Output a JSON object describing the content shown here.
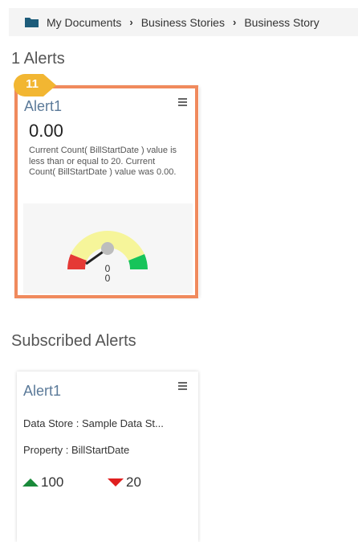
{
  "breadcrumb": {
    "items": [
      "My Documents",
      "Business Stories",
      "Business Story"
    ]
  },
  "alerts_section": {
    "title": "1 Alerts",
    "card": {
      "name": "Alert1",
      "value": "0.00",
      "description": "Current Count( BillStartDate ) value is less than or equal to 20. Current Count( BillStartDate ) value was 0.00.",
      "gauge_value_label": "0",
      "gauge_min_label": "0",
      "gauge_needle_fraction": 0.0
    },
    "step_badge": "11"
  },
  "subscribed_section": {
    "title": "Subscribed Alerts",
    "card": {
      "name": "Alert1",
      "data_store_row": "Data Store : Sample Data St...",
      "property_row": "Property : BillStartDate",
      "upper_threshold": "100",
      "lower_threshold": "20"
    }
  },
  "colors": {
    "folder": "#1d5c7a",
    "highlight": "#f08a5d",
    "badge": "#f2b632",
    "gauge_red": "#e53935",
    "gauge_yellow": "#f6f59a",
    "gauge_green": "#17c45a",
    "up": "#1a8a3a",
    "down": "#e02020"
  }
}
